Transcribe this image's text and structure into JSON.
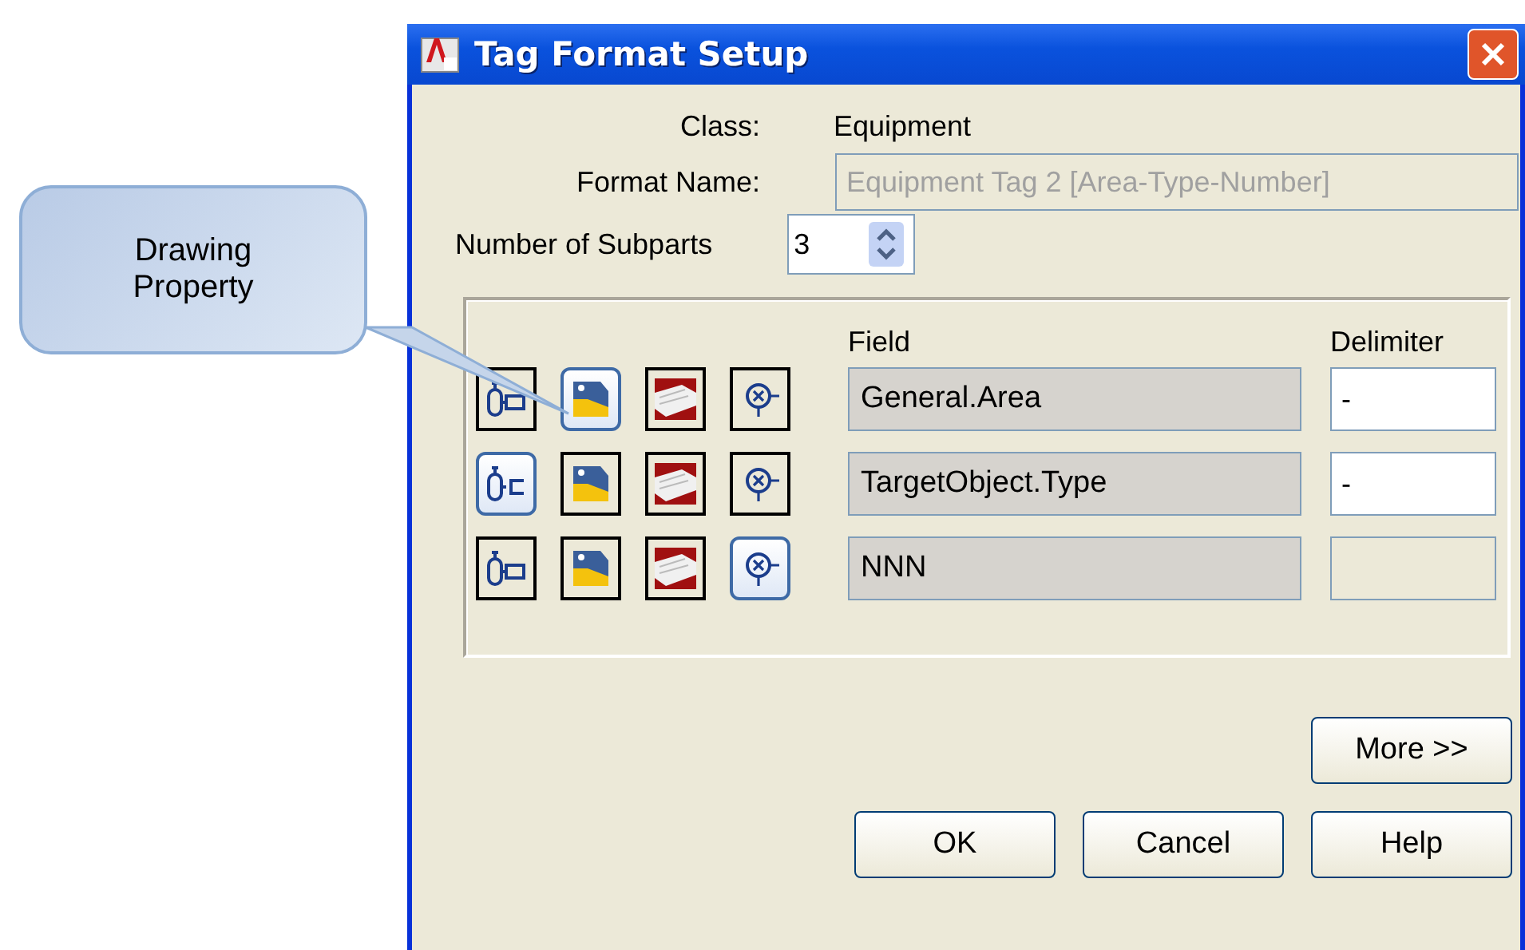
{
  "window": {
    "title": "Tag Format Setup"
  },
  "callout": {
    "text": "Drawing\nProperty"
  },
  "class": {
    "label": "Class:",
    "value": "Equipment"
  },
  "format_name": {
    "label": "Format Name:",
    "value": "Equipment Tag 2 [Area-Type-Number]",
    "disabled": true
  },
  "subparts": {
    "label": "Number of Subparts",
    "value": "3"
  },
  "columns": {
    "field": "Field",
    "delimiter": "Delimiter"
  },
  "rows": [
    {
      "sources": [
        {
          "kind": "equipment",
          "selected": false
        },
        {
          "kind": "drawing",
          "selected": true
        },
        {
          "kind": "project",
          "selected": false
        },
        {
          "kind": "expression",
          "selected": false
        }
      ],
      "field": "General.Area",
      "delimiter": "-",
      "delimiter_disabled": false
    },
    {
      "sources": [
        {
          "kind": "equipment",
          "selected": true
        },
        {
          "kind": "drawing",
          "selected": false
        },
        {
          "kind": "project",
          "selected": false
        },
        {
          "kind": "expression",
          "selected": false
        }
      ],
      "field": "TargetObject.Type",
      "delimiter": "-",
      "delimiter_disabled": false
    },
    {
      "sources": [
        {
          "kind": "equipment",
          "selected": false
        },
        {
          "kind": "drawing",
          "selected": false
        },
        {
          "kind": "project",
          "selected": false
        },
        {
          "kind": "expression",
          "selected": true
        }
      ],
      "field": "NNN",
      "delimiter_disabled": true
    }
  ],
  "more_button": "More >>",
  "buttons": [
    "OK",
    "Cancel",
    "Help"
  ]
}
